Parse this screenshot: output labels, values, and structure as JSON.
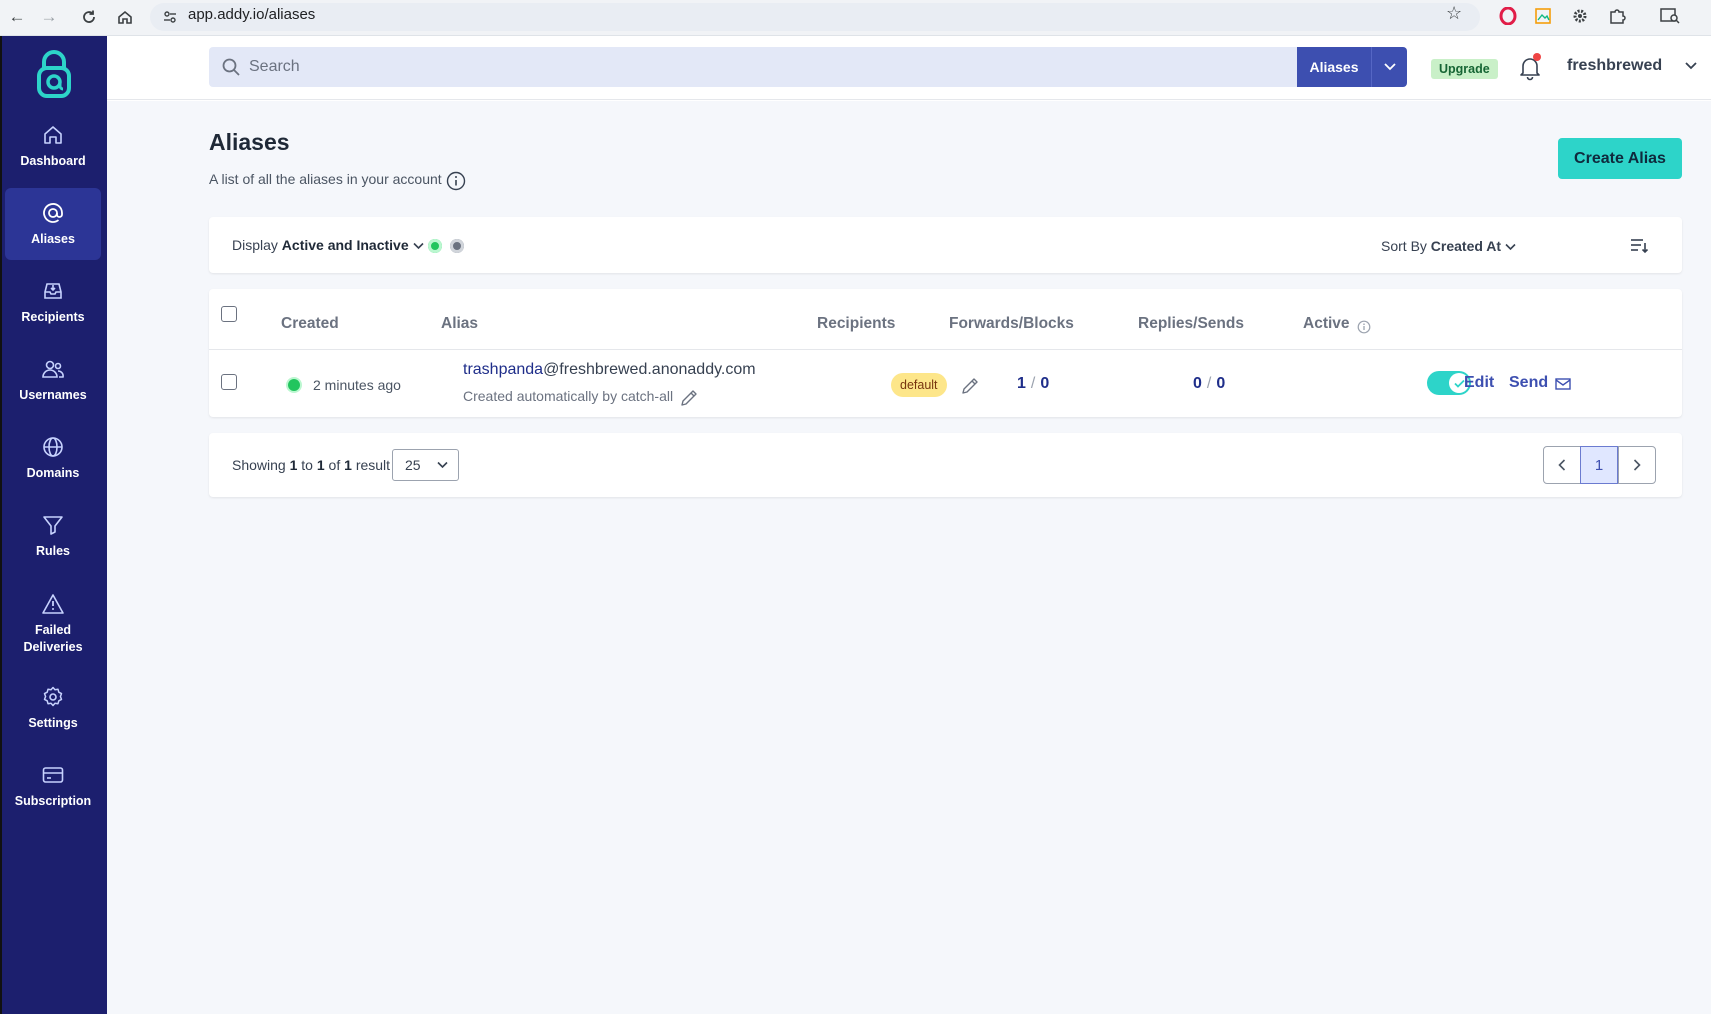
{
  "browser": {
    "url": "app.addy.io/aliases"
  },
  "sidebar": {
    "items": [
      {
        "label": "Dashboard",
        "icon": "home-icon"
      },
      {
        "label": "Aliases",
        "icon": "at-sign-icon"
      },
      {
        "label": "Recipients",
        "icon": "inbox-icon"
      },
      {
        "label": "Usernames",
        "icon": "users-icon"
      },
      {
        "label": "Domains",
        "icon": "globe-icon"
      },
      {
        "label": "Rules",
        "icon": "filter-icon"
      },
      {
        "label": "Failed Deliveries",
        "icon": "warning-icon"
      },
      {
        "label": "Settings",
        "icon": "gear-icon"
      },
      {
        "label": "Subscription",
        "icon": "credit-card-icon"
      }
    ],
    "active": "Aliases"
  },
  "header": {
    "search_placeholder": "Search",
    "search_scope": "Aliases",
    "upgrade_label": "Upgrade",
    "username": "freshbrewed"
  },
  "page": {
    "title": "Aliases",
    "subtitle": "A list of all the aliases in your account",
    "create_button": "Create Alias"
  },
  "filters": {
    "display_prefix": "Display",
    "display_value": "Active and Inactive",
    "sort_prefix": "Sort By",
    "sort_value": "Created At"
  },
  "table": {
    "columns": [
      "Created",
      "Alias",
      "Recipients",
      "Forwards/Blocks",
      "Replies/Sends",
      "Active"
    ],
    "rows": [
      {
        "created": "2 minutes ago",
        "alias_local": "trashpanda",
        "alias_domain": "@freshbrewed.anonaddy.com",
        "description": "Created automatically by catch-all",
        "recipient_badge": "default",
        "forwards": "1",
        "blocks": "0",
        "replies": "0",
        "sends": "0",
        "active": true,
        "edit_label": "Edit",
        "send_label": "Send"
      }
    ]
  },
  "pagination": {
    "showing_word": "Showing",
    "from": "1",
    "to_word": "to",
    "to": "1",
    "of_word": "of",
    "total": "1",
    "result_word": "result",
    "per_page": "25",
    "current_page": "1"
  },
  "colors": {
    "sidebar": "#1c1f6e",
    "sidebar_active": "#2c3596",
    "accent": "#2dd4c9",
    "primary": "#3d4fb0"
  }
}
